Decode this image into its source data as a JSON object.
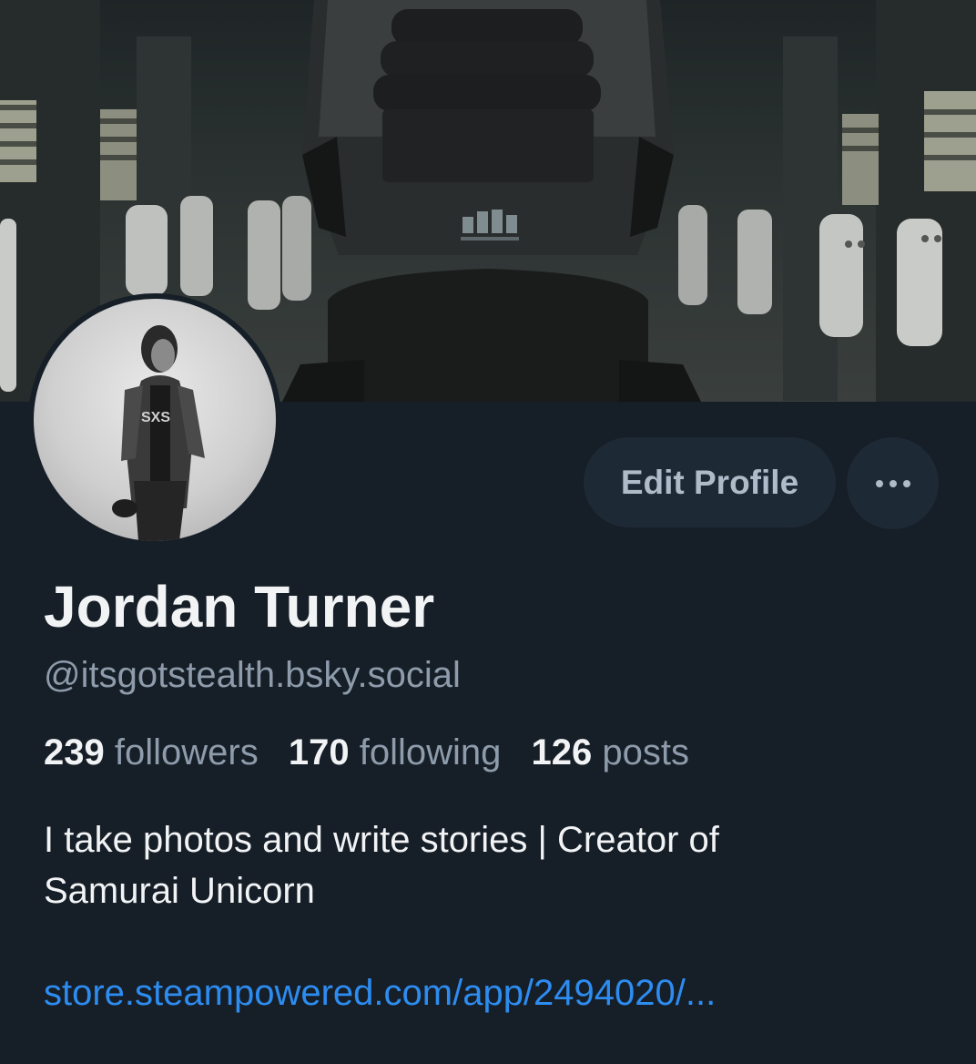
{
  "profile": {
    "display_name": "Jordan Turner",
    "handle": "@itsgotstealth.bsky.social",
    "bio_line1": "I take photos and write stories | Creator of",
    "bio_line2": "Samurai Unicorn",
    "link": "store.steampowered.com/app/2494020/..."
  },
  "stats": {
    "followers_count": "239",
    "followers_label": "followers",
    "following_count": "170",
    "following_label": "following",
    "posts_count": "126",
    "posts_label": "posts"
  },
  "actions": {
    "edit_profile_label": "Edit Profile",
    "more_icon": "ellipsis-icon"
  },
  "colors": {
    "background": "#161e27",
    "button_bg": "#1e2936",
    "primary_text": "#f1f3f5",
    "secondary_text": "#8d9bab",
    "link": "#2d8cf0"
  }
}
